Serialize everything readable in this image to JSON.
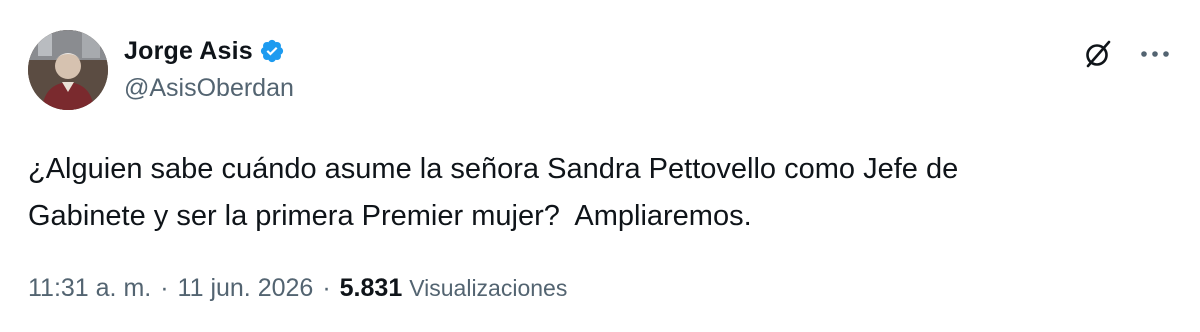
{
  "author": {
    "display_name": "Jorge Asis",
    "handle": "@AsisOberdan",
    "verified_color": "#1d9bf0"
  },
  "icons": {
    "grok": "grok-icon",
    "more": "more-dots-icon",
    "verified": "verified-badge-icon"
  },
  "tweet": {
    "text": "¿Alguien sabe cuándo asume la señora Sandra Pettovello como Jefe de\nGabinete y ser la primera Premier mujer?  Ampliaremos."
  },
  "meta": {
    "time": "11:31 a. m.",
    "separator": "·",
    "date": "11 jun. 2026",
    "views_count": "5.831",
    "views_label": "Visualizaciones"
  }
}
